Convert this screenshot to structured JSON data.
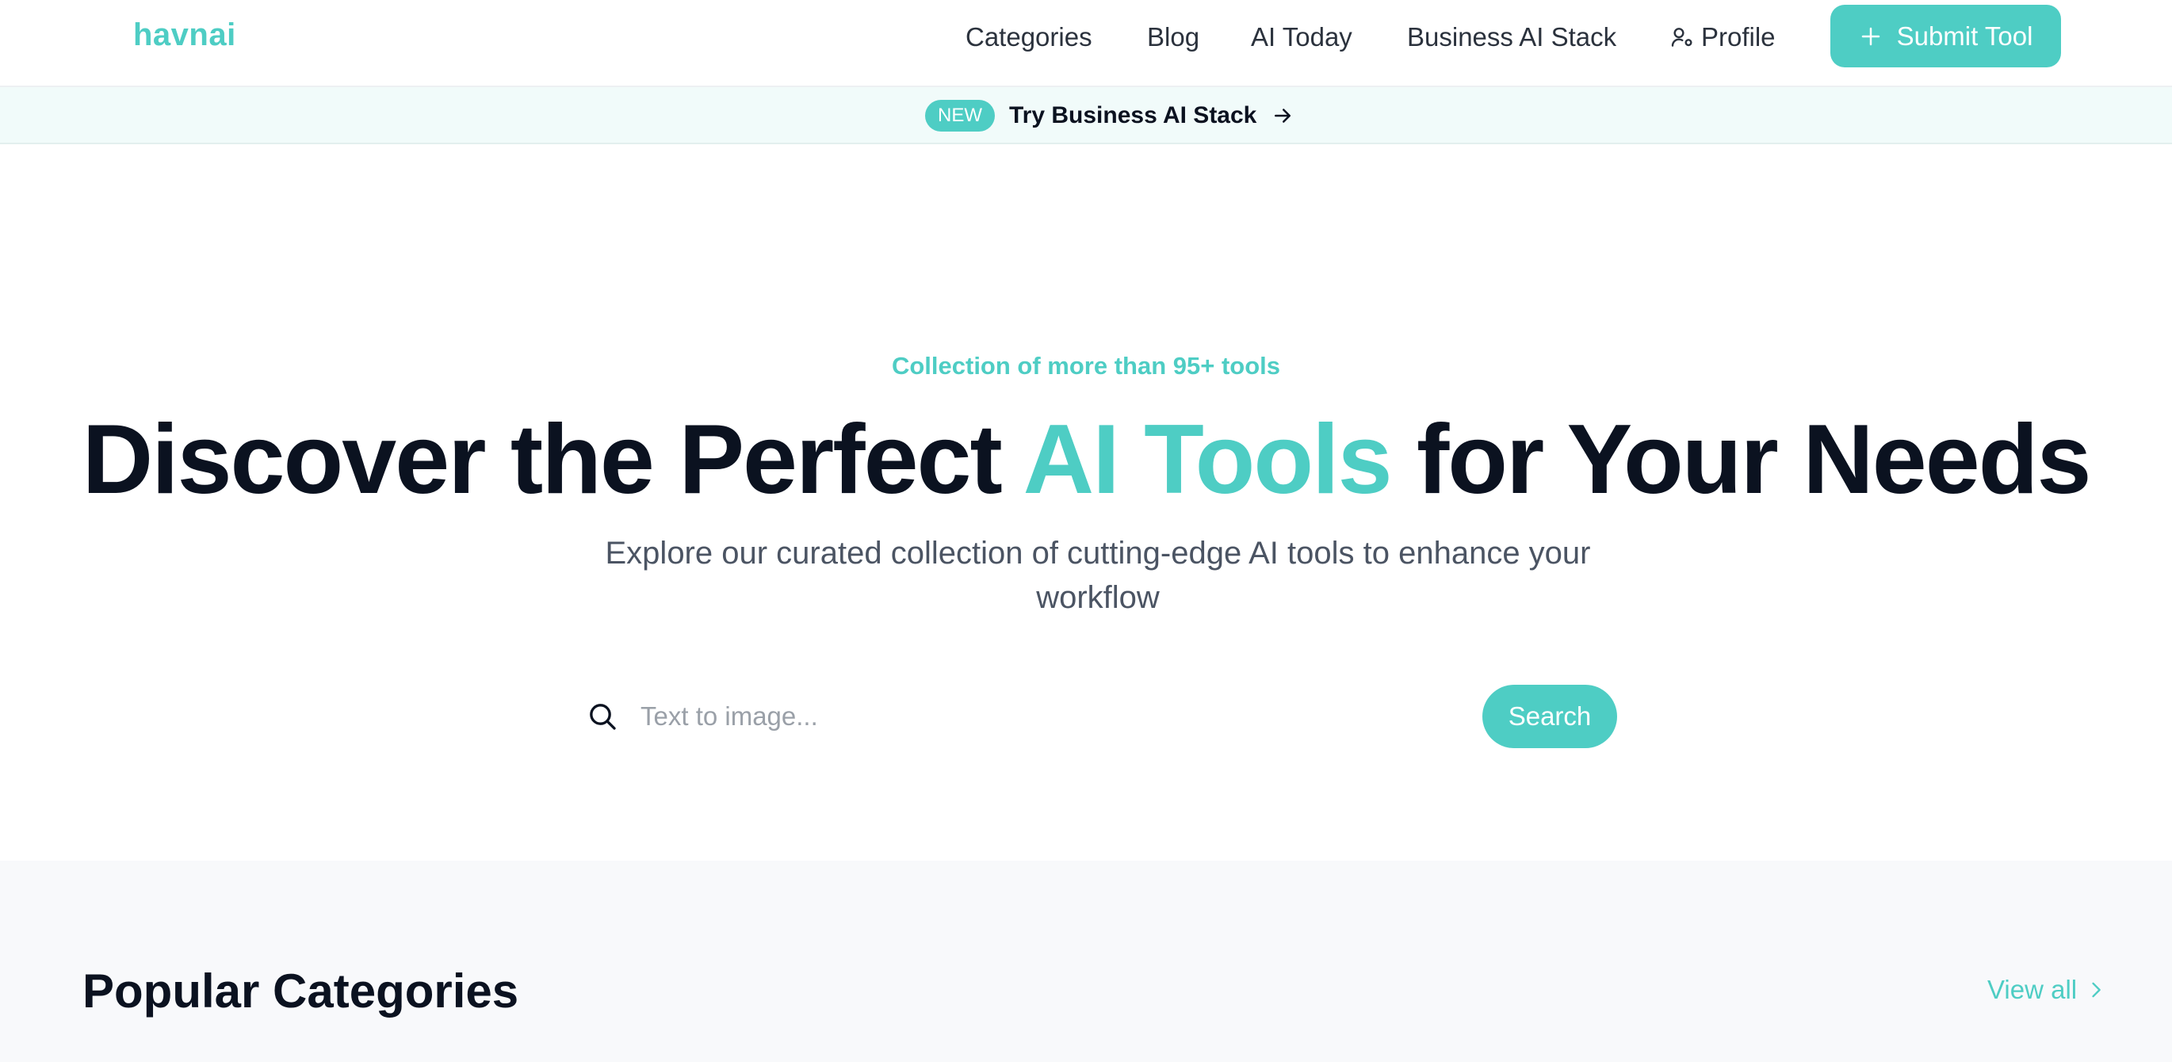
{
  "header": {
    "logo": "havnai",
    "nav": {
      "categories": "Categories",
      "blog": "Blog",
      "ai_today": "AI Today",
      "business_ai_stack": "Business AI Stack",
      "profile": "Profile"
    },
    "submit_label": "Submit Tool",
    "submit_icon": "plus-icon",
    "profile_icon": "user-gear-icon"
  },
  "banner": {
    "badge": "NEW",
    "text": "Try Business AI Stack",
    "icon": "arrow-right-icon"
  },
  "hero": {
    "kicker": "Collection of more than 95+ tools",
    "title_before": "Discover the Perfect",
    "title_accent": "AI Tools",
    "title_after": "for Your Needs",
    "subtitle": "Explore our curated collection of cutting-edge AI tools to enhance your workflow",
    "search": {
      "icon": "search-icon",
      "placeholder": "Text to image...",
      "value": "",
      "button_label": "Search"
    }
  },
  "popular": {
    "title": "Popular Categories",
    "view_all": "View all",
    "view_all_icon": "chevron-right-icon"
  },
  "colors": {
    "accent": "#4ecdc4",
    "heading": "#0b1220",
    "body_text": "#4b5463",
    "banner_bg": "#f1fbfa",
    "section_bg": "#f8f9fb"
  }
}
